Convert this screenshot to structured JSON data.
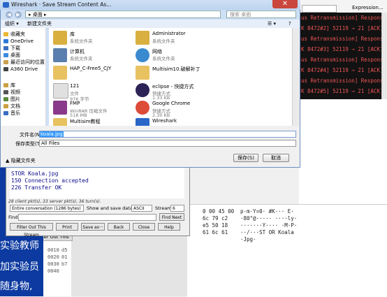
{
  "save_dialog": {
    "title": "Wireshark · Save Stream Content As...",
    "close_glyph": "✕",
    "address": "▸ 桌面 ▸",
    "search_placeholder": "搜索 桌面",
    "toolbar": {
      "organize": "组织 ▾",
      "new_folder": "新建文件夹",
      "view": "☰ ▾",
      "help": "?"
    },
    "nav": [
      {
        "label": "收藏夹",
        "icon": "star-icon",
        "color": "#e8b830"
      },
      {
        "label": "OneDrive",
        "icon": "cloud-icon",
        "color": "#2a7ad8"
      },
      {
        "label": "下载",
        "icon": "download-folder-icon",
        "color": "#3a6ec0"
      },
      {
        "label": "桌面",
        "icon": "desktop-icon",
        "color": "#3a8ae0"
      },
      {
        "label": "最近访问的位置",
        "icon": "recent-icon",
        "color": "#caa050"
      },
      {
        "label": "A360 Drive",
        "icon": "drive-icon",
        "color": "#444"
      },
      {
        "label": "库",
        "icon": "library-icon",
        "color": "#c9a040"
      },
      {
        "label": "视频",
        "icon": "video-icon",
        "color": "#555"
      },
      {
        "label": "图片",
        "icon": "picture-icon",
        "color": "#5a8a3a"
      },
      {
        "label": "文档",
        "icon": "document-icon",
        "color": "#c9a040"
      },
      {
        "label": "音乐",
        "icon": "music-icon",
        "color": "#3a6ec0"
      }
    ],
    "files": [
      {
        "name": "库",
        "sub": "系统文件夹",
        "sub2": "",
        "icon": "library-folder-icon",
        "color": "#d9b040"
      },
      {
        "name": "Administrator",
        "sub": "系统文件夹",
        "sub2": "",
        "icon": "user-folder-icon",
        "color": "#d9b040"
      },
      {
        "name": "计算机",
        "sub": "系统文件夹",
        "sub2": "",
        "icon": "computer-icon",
        "color": "#5a7fae"
      },
      {
        "name": "网络",
        "sub": "系统文件夹",
        "sub2": "",
        "icon": "network-icon",
        "color": "#3a8ad0"
      },
      {
        "name": "HAP_C-Free5_CJY",
        "sub": "",
        "sub2": "",
        "icon": "folder-icon",
        "color": "#e8c160"
      },
      {
        "name": "Multisim10.破解补丁",
        "sub": "",
        "sub2": "",
        "icon": "folder-icon",
        "color": "#e8c160"
      },
      {
        "name": "121",
        "sub": "文件",
        "sub2": "976 字节",
        "icon": "file-icon",
        "color": "#e0e0e0"
      },
      {
        "name": "eclipse - 快捷方式",
        "sub": "快捷方式",
        "sub2": "1.33 KB",
        "icon": "eclipse-icon",
        "color": "#2c2255"
      },
      {
        "name": "FMP",
        "sub": "WinRAR 压缩文件",
        "sub2": "518 MB",
        "icon": "archive-icon",
        "color": "#8a3a8a"
      },
      {
        "name": "Google Chrome",
        "sub": "快捷方式",
        "sub2": "2.30 KB",
        "icon": "chrome-icon",
        "color": "#dd4b39"
      },
      {
        "name": "Multisim教程",
        "sub": "",
        "sub2": "",
        "icon": "folder-icon",
        "color": "#e8c160"
      },
      {
        "name": "Wireshark",
        "sub": "",
        "sub2": "",
        "icon": "wireshark-icon",
        "color": "#2a66c8"
      }
    ],
    "filename_label": "文件名(N):",
    "filename_value": "koala.jpg",
    "filetype_label": "保存类型(T):",
    "filetype_value": "All Files",
    "hide_folders": "隐藏文件夹",
    "save_button": "保存(S)",
    "cancel_button": "取消"
  },
  "wireshark": {
    "expression_button": "Expression...",
    "packets": [
      "us Retransmission] Response: 421",
      "K 8472#2] 52119 → 21 [ACK] Seq=2",
      "us Retransmission] Response: 421",
      "K 8472#3] 52119 → 21 [ACK] Seq=2",
      "us Retransmission] Response: 421",
      "K 8472#4] 52119 → 21 [ACK] Seq=2",
      "us Retransmission] Response: 421",
      "K 8472#5] 52119 → 21 [ACK] Seq=2"
    ],
    "hex_rows": [
      {
        "hex": "0 00 45 00",
        "ascii": "p·m·Y=0· #K··· E·"
      },
      {
        "hex": "6c 79 c2",
        "ascii": "·80°@····· ····ly·"
      },
      {
        "hex": "e5 50 18",
        "ascii": "·······Y···· ·M·P·"
      },
      {
        "hex": "61 6c 61",
        "ascii": "··/···ST OR Koala"
      },
      {
        "hex": "",
        "ascii": "·Jpg·"
      }
    ],
    "offsets": [
      "0010",
      "0020",
      "0030",
      "0040"
    ],
    "offsets_short": [
      "d5",
      "01",
      "b7"
    ],
    "left_tab": "Filter Out This"
  },
  "follow_stream": {
    "lines": [
      "STOR Koala.jpg",
      "150 Connection accepted",
      "226 Transfer OK"
    ],
    "summary": "28 client pkt(s), 33 server pkt(s), 36 turn(s).",
    "conversation": "Entire conversation (1286 bytes)",
    "show_as_label": "Show and save data as",
    "show_as_value": "ASCII",
    "stream_label": "Stream",
    "stream_value": "6",
    "find_label": "Find:",
    "find_next": "Find Next",
    "buttons": [
      "Filter Out This Stream",
      "Print",
      "Save as···",
      "Back",
      "Close",
      "Help"
    ]
  },
  "background_text": [
    "实验教师",
    "加实验员",
    "随身物,"
  ]
}
